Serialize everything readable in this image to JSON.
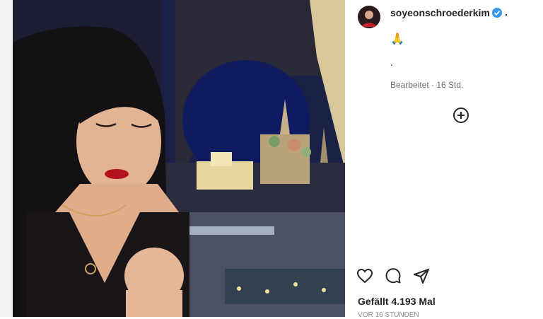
{
  "post": {
    "image_description_icon": "photo-icon",
    "username": "soyeonschroederkim",
    "verified_icon": "verified-badge-icon",
    "separator": ".",
    "caption_emoji": "🙏",
    "caption_text": ".",
    "edited_label": "Bearbeitet · 16 Std.",
    "add_icon": "add-circle-icon",
    "actions": {
      "like_icon": "heart-icon",
      "comment_icon": "comment-icon",
      "share_icon": "send-icon"
    },
    "likes_label": "Gefällt 4.193 Mal",
    "timestamp_cut": "VOR 16 STUNDEN"
  },
  "colors": {
    "accent_verified": "#3897f0",
    "text_primary": "#262626",
    "text_secondary": "#6b6b6b"
  }
}
